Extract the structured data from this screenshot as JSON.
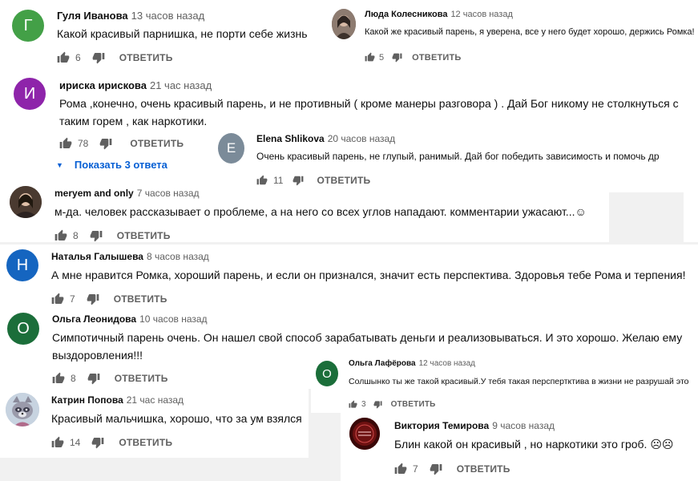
{
  "comments": [
    {
      "initial": "Г",
      "color": "#43a047",
      "author": "Гуля Иванова",
      "time": "13 часов назад",
      "text": "Какой красивый парнишка, не порти себе жизнь",
      "likes": "6",
      "reply": "ОТВЕТИТЬ"
    },
    {
      "initial": "",
      "color": "#6b5a52",
      "author": "Люда Колесникова",
      "time": "12 часов назад",
      "text": "Какой же красивый парень, я уверена, все у него будет хорошо, держись Ромка!",
      "likes": "5",
      "reply": "ОТВЕТИТЬ"
    },
    {
      "initial": "И",
      "color": "#8e24aa",
      "author": "ириска ирискова",
      "time": "21 час назад",
      "text": "Рома ,конечно, очень красивый парень, и не противный ( кроме манеры разговора ) . Дай Бог никому не столкнуться с таким горем , как наркотики.",
      "likes": "78",
      "reply": "ОТВЕТИТЬ",
      "show_replies": "Показать 3 ответа"
    },
    {
      "initial": "E",
      "color": "#7b8b99",
      "author": "Elena Shlikova",
      "time": "20 часов назад",
      "text": "Очень красивый парень, не глупый, ранимый. Дай бог победить зависимость и помочь др",
      "likes": "11",
      "reply": "ОТВЕТИТЬ"
    },
    {
      "initial": "",
      "color": "#5a4a3e",
      "author": "meryem and only",
      "time": "7 часов назад",
      "text": "м-да. человек рассказывает о проблеме, а на него со всех углов нападают. комментарии ужасают...☺",
      "likes": "8",
      "reply": "ОТВЕТИТЬ"
    },
    {
      "initial": "Н",
      "color": "#1565c0",
      "author": "Наталья Галышева",
      "time": "8 часов назад",
      "text": "А мне нравится Ромка, хороший парень, и если он признался, значит есть перспектива. Здоровья тебе Рома и терпения!",
      "likes": "7",
      "reply": "ОТВЕТИТЬ"
    },
    {
      "initial": "О",
      "color": "#1b6e3a",
      "author": "Ольга Леонидова",
      "time": "10 часов назад",
      "text": "Симпотичный парень очень. Он нашел свой способ зарабатывать деньги и реализовываться. И это хорошо. Желаю ему выздоровления!!!",
      "likes": "8",
      "reply": "ОТВЕТИТЬ"
    },
    {
      "initial": "О",
      "color": "#1b6e3a",
      "author": "Ольга Лафёрова",
      "time": "12 часов назад",
      "text": "Солшынко ты же такой красивый.У тебя такая перспертктива в жизни не разрушай это",
      "likes": "3",
      "reply": "ОТВЕТИТЬ"
    },
    {
      "initial": "",
      "color": "#b9c6d6",
      "author": "Катрин Попова",
      "time": "21 час назад",
      "text": "Красивый мальчишка, хорошо, что за ум взялся",
      "likes": "14",
      "reply": "ОТВЕТИТЬ"
    },
    {
      "initial": "",
      "color": "#5c0d0d",
      "author": "Виктория Темирова",
      "time": "9 часов назад",
      "text": "Блин какой он красивый , но наркотики это гроб. ☹☹",
      "likes": "7",
      "reply": "ОТВЕТИТЬ"
    }
  ]
}
